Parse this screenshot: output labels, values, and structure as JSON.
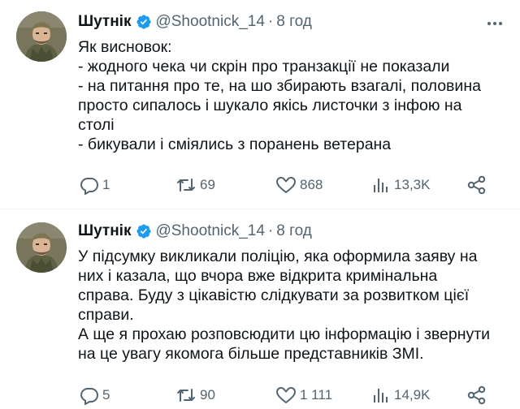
{
  "tweets": [
    {
      "author_name": "Шутнік",
      "handle": "@Shootnick_14",
      "separator": "·",
      "time": "8 год",
      "lines": [
        "Як висновок:",
        "- жодного чека чи скрін про транзакції не показали",
        "- на питання про те, на шо збирають взагалі, половина",
        "просто сипалось і шукало якісь листочки з інфою на",
        "столі",
        "- бикували і сміялись з поранень ветерана"
      ],
      "replies": "1",
      "retweets": "69",
      "likes": "868",
      "views": "13,3K"
    },
    {
      "author_name": "Шутнік",
      "handle": "@Shootnick_14",
      "separator": "·",
      "time": "8 год",
      "lines": [
        "У підсумку викликали поліцію, яка оформила заяву на",
        "них і казала, що вчора вже відкрита кримінальна",
        "справа. Буду з цікавістю слідкувати за розвитком цієї",
        "справи.",
        "А ще я прохаю розповсюдити цю інформацію і звернути",
        "на це увагу якомога більше представників ЗМІ."
      ],
      "replies": "5",
      "retweets": "90",
      "likes": "1 111",
      "views": "14,9K"
    }
  ],
  "icons": {
    "verified": "verified-badge-icon",
    "more": "more-dots-icon",
    "reply": "reply-icon",
    "retweet": "retweet-icon",
    "like": "heart-icon",
    "views": "views-chart-icon",
    "share": "share-icon"
  },
  "colors": {
    "text": "#0f1419",
    "secondary": "#536471",
    "verified": "#1d9bf0",
    "divider": "#eff3f4"
  }
}
